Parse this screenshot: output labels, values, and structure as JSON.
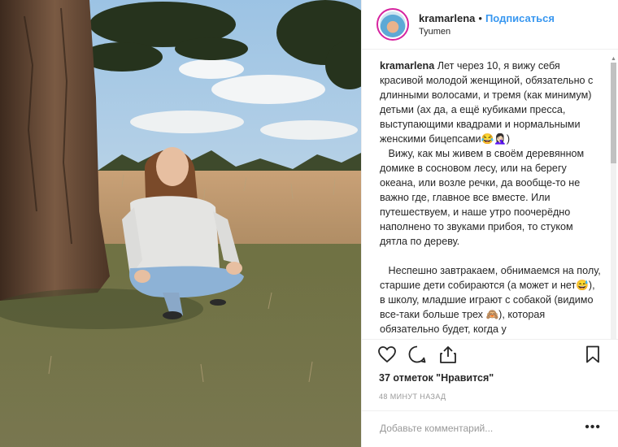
{
  "post": {
    "username": "kramarlena",
    "separator": "•",
    "follow_label": "Подписаться",
    "location": "Tyumen",
    "caption_user": "kramarlena",
    "caption_text": " Лет через 10, я вижу себя красивой молодой женщиной, обязательно с длинными волосами, и тремя (как минимум) детьми (ах да, а ещё кубиками пресса, выступающими квадрами и нормальными женскими бицепсами😂🤦🏻‍♀️)\n   Вижу, как мы живем в своём деревянном домике в сосновом лесу, или на берегу океана, или возле речки, да вообще-то не важно где, главное все вместе. Или путешествуем, и наше утро поочерёдно наполнено то звуками прибоя, то стуком дятла по дереву.\n\n   Неспешно завтракаем, обнимаемся на полу, старшие дети собираются (а может и нет😅), в школу, младшие играют с собакой (видимо все-таки больше трех 🙈), которая обязательно будет, когда у",
    "likes_text": "37 отметок \"Нравится\"",
    "time_text": "48 МИНУТ НАЗАД",
    "comment_placeholder": "Добавьте комментарий...",
    "more_label": "•••"
  },
  "icons": {
    "like": "heart-icon",
    "comment": "comment-icon",
    "share": "share-icon",
    "save": "bookmark-icon"
  },
  "colors": {
    "follow": "#3897f0",
    "text": "#262626",
    "muted": "#999999",
    "border": "#efefef"
  }
}
